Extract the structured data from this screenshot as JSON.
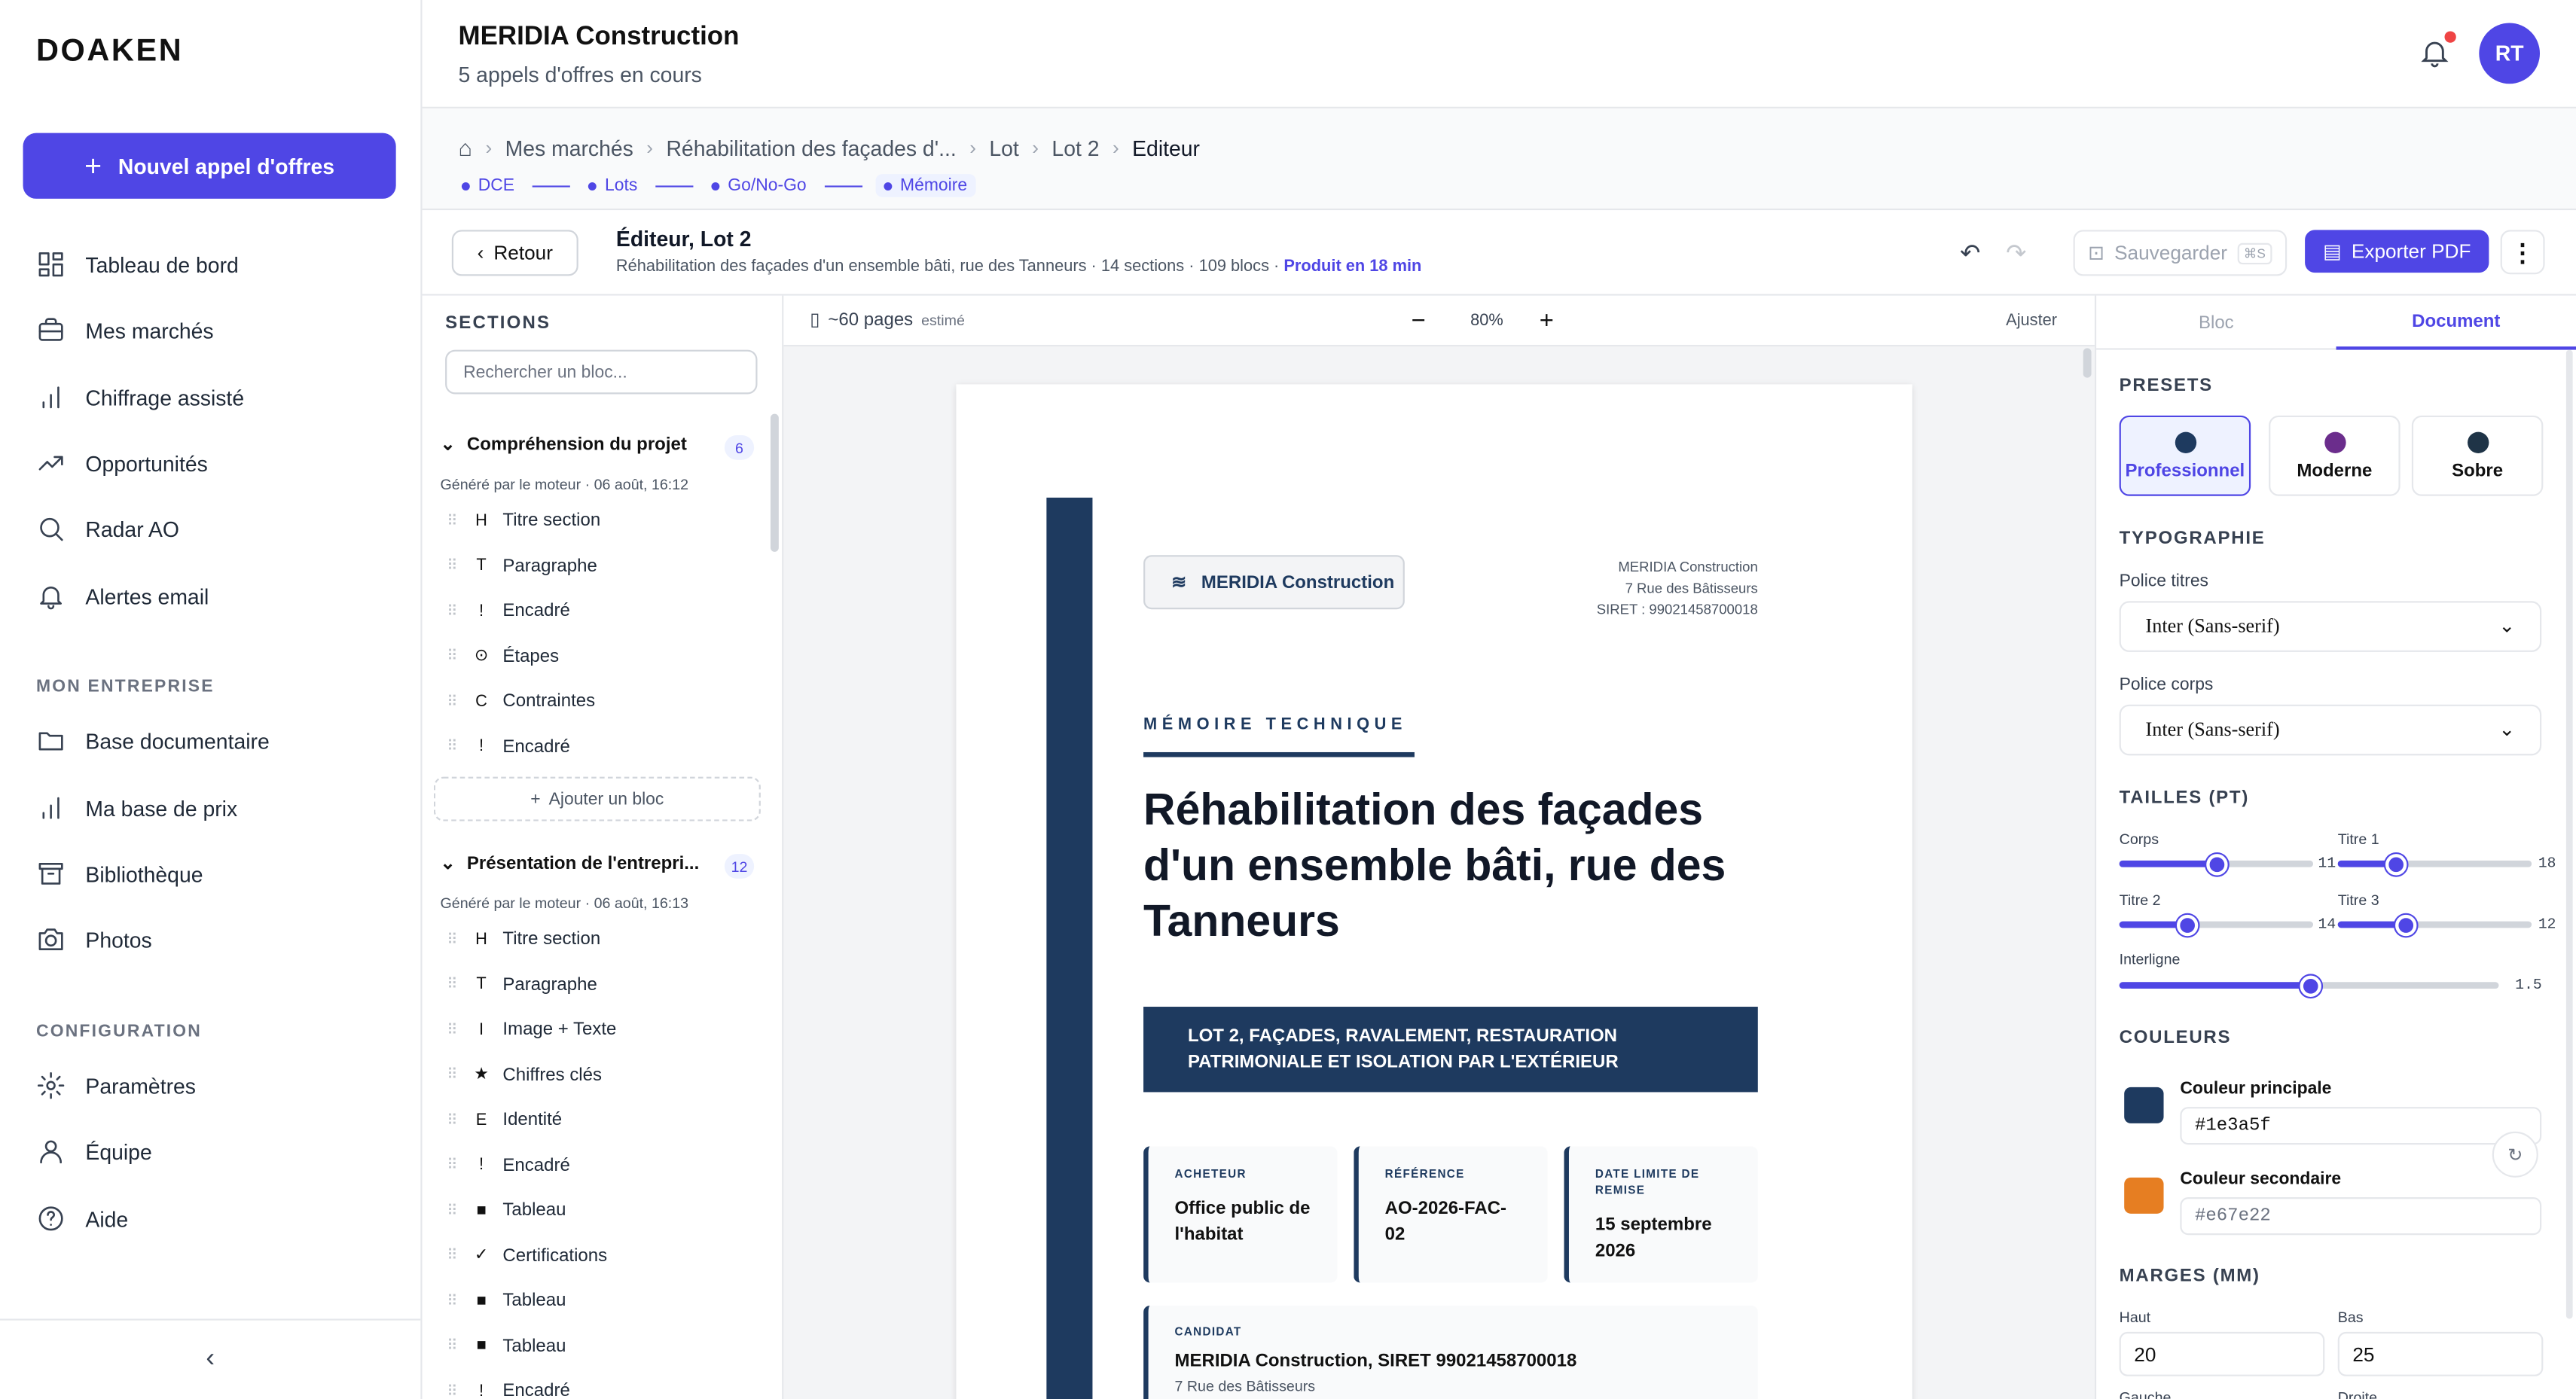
{
  "sidebar": {
    "logo": "DOAKEN",
    "new_button": "Nouvel appel d'offres",
    "items": [
      "Tableau de bord",
      "Mes marchés",
      "Chiffrage assisté",
      "Opportunités",
      "Radar AO",
      "Alertes email"
    ],
    "section_company": "MON ENTREPRISE",
    "company_items": [
      "Base documentaire",
      "Ma base de prix",
      "Bibliothèque",
      "Photos"
    ],
    "section_config": "CONFIGURATION",
    "config_items": [
      "Paramètres",
      "Équipe",
      "Aide"
    ]
  },
  "header": {
    "title": "MERIDIA Construction",
    "subtitle": "5 appels d'offres en cours",
    "avatar": "RT"
  },
  "breadcrumb": [
    "Mes marchés",
    "Réhabilitation des façades d'...",
    "Lot",
    "Lot 2",
    "Editeur"
  ],
  "steps": [
    "DCE",
    "Lots",
    "Go/No-Go",
    "Mémoire"
  ],
  "toolbar": {
    "back": "Retour",
    "title": "Éditeur, Lot 2",
    "subtitle": "Réhabilitation des façades d'un ensemble bâti, rue des Tanneurs · 14 sections · 109 blocs · ",
    "produced": "Produit en 18 min",
    "save": "Sauvegarder",
    "save_kbd": "⌘S",
    "export": "Exporter PDF"
  },
  "sections_panel": {
    "title": "SECTIONS",
    "search_placeholder": "Rechercher un bloc...",
    "add_block": "Ajouter un bloc",
    "groups": [
      {
        "title": "Compréhension du projet",
        "count": "6",
        "generated": "Généré par le moteur · 06 août, 16:12",
        "blocks": [
          {
            "icon": "H",
            "label": "Titre section"
          },
          {
            "icon": "T",
            "label": "Paragraphe"
          },
          {
            "icon": "!",
            "label": "Encadré"
          },
          {
            "icon": "⊙",
            "label": "Étapes"
          },
          {
            "icon": "C",
            "label": "Contraintes"
          },
          {
            "icon": "!",
            "label": "Encadré"
          }
        ]
      },
      {
        "title": "Présentation de l'entrepri...",
        "count": "12",
        "generated": "Généré par le moteur · 06 août, 16:13",
        "blocks": [
          {
            "icon": "H",
            "label": "Titre section"
          },
          {
            "icon": "T",
            "label": "Paragraphe"
          },
          {
            "icon": "I",
            "label": "Image + Texte"
          },
          {
            "icon": "★",
            "label": "Chiffres clés"
          },
          {
            "icon": "E",
            "label": "Identité"
          },
          {
            "icon": "!",
            "label": "Encadré"
          },
          {
            "icon": "■",
            "label": "Tableau"
          },
          {
            "icon": "✓",
            "label": "Certifications"
          },
          {
            "icon": "■",
            "label": "Tableau"
          },
          {
            "icon": "■",
            "label": "Tableau"
          },
          {
            "icon": "!",
            "label": "Encadré"
          }
        ]
      }
    ]
  },
  "canvas": {
    "pages": "~60 pages",
    "estimated": "estimé",
    "zoom": "80%",
    "fit": "Ajuster"
  },
  "document": {
    "badge": "MERIDIA Construction",
    "addr1": "MERIDIA Construction",
    "addr2": "7 Rue des Bâtisseurs",
    "addr3": "SIRET : 99021458700018",
    "kicker": "MÉMOIRE TECHNIQUE",
    "title": "Réhabilitation des façades d'un ensemble bâti, rue des Tanneurs",
    "lot_banner": "LOT 2, FAÇADES, RAVALEMENT, RESTAURATION PATRIMONIALE ET ISOLATION PAR L'EXTÉRIEUR",
    "cards": [
      {
        "k": "ACHETEUR",
        "v": "Office public de l'habitat"
      },
      {
        "k": "RÉFÉRENCE",
        "v": "AO-2026-FAC-02"
      },
      {
        "k": "DATE LIMITE DE REMISE",
        "v": "15 septembre 2026"
      }
    ],
    "candidate_label": "CANDIDAT",
    "candidate": "MERIDIA Construction, SIRET 99021458700018",
    "candidate_addr": "7 Rue des Bâtisseurs"
  },
  "right_panel": {
    "tabs": [
      "Bloc",
      "Document"
    ],
    "active_tab": "Document",
    "presets_title": "PRESETS",
    "presets": [
      {
        "name": "Professionnel",
        "color": "#1e3a5f"
      },
      {
        "name": "Moderne",
        "color": "#6b2d8c"
      },
      {
        "name": "Sobre",
        "color": "#1f3447"
      }
    ],
    "typo_title": "TYPOGRAPHIE",
    "font_titles_label": "Police titres",
    "font_titles": "Inter (Sans-serif)",
    "font_body_label": "Police corps",
    "font_body": "Inter (Sans-serif)",
    "sizes_title": "TAILLES (PT)",
    "sizes": {
      "corps": {
        "label": "Corps",
        "value": "11",
        "fraction": 0.5
      },
      "titre1": {
        "label": "Titre 1",
        "value": "18",
        "fraction": 0.3
      },
      "titre2": {
        "label": "Titre 2",
        "value": "14",
        "fraction": 0.35
      },
      "titre3": {
        "label": "Titre 3",
        "value": "12",
        "fraction": 0.35
      },
      "interligne": {
        "label": "Interligne",
        "value": "1.5",
        "fraction": 0.5
      }
    },
    "colors_title": "COULEURS",
    "primary_label": "Couleur principale",
    "primary": "#1e3a5f",
    "secondary_label": "Couleur secondaire",
    "secondary": "#e67e22",
    "margins_title": "MARGES (MM)",
    "top_label": "Haut",
    "top": "20",
    "bottom_label": "Bas",
    "bottom": "25",
    "left_label": "Gauche",
    "right_label": "Droite"
  }
}
